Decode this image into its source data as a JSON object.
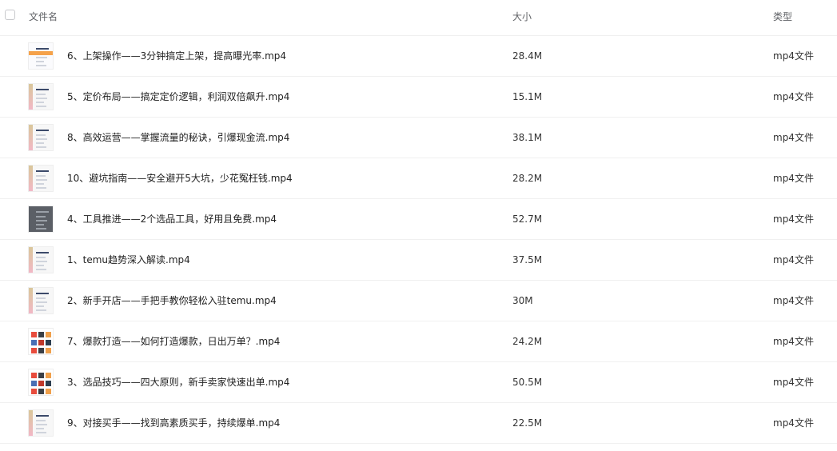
{
  "header": {
    "name_label": "文件名",
    "size_label": "大小",
    "type_label": "类型"
  },
  "rows": [
    {
      "name": "6、上架操作——3分钟搞定上架，提高曝光率.mp4",
      "size": "28.4M",
      "type": "mp4文件",
      "thumb": "orange"
    },
    {
      "name": "5、定价布局——搞定定价逻辑，利润双倍飙升.mp4",
      "size": "15.1M",
      "type": "mp4文件",
      "thumb": "doc"
    },
    {
      "name": "8、高效运营——掌握流量的秘诀，引爆现金流.mp4",
      "size": "38.1M",
      "type": "mp4文件",
      "thumb": "doc"
    },
    {
      "name": "10、避坑指南——安全避开5大坑，少花冤枉钱.mp4",
      "size": "28.2M",
      "type": "mp4文件",
      "thumb": "doc"
    },
    {
      "name": "4、工具推进——2个选品工具，好用且免费.mp4",
      "size": "52.7M",
      "type": "mp4文件",
      "thumb": "dark"
    },
    {
      "name": "1、temu趋势深入解读.mp4",
      "size": "37.5M",
      "type": "mp4文件",
      "thumb": "doc"
    },
    {
      "name": "2、新手开店——手把手教你轻松入驻temu.mp4",
      "size": "30M",
      "type": "mp4文件",
      "thumb": "doc"
    },
    {
      "name": "7、爆款打造——如何打造爆款，日出万单？.mp4",
      "size": "24.2M",
      "type": "mp4文件",
      "thumb": "grid"
    },
    {
      "name": "3、选品技巧——四大原则，新手卖家快速出单.mp4",
      "size": "50.5M",
      "type": "mp4文件",
      "thumb": "grid"
    },
    {
      "name": "9、对接买手——找到高素质买手，持续爆单.mp4",
      "size": "22.5M",
      "type": "mp4文件",
      "thumb": "doc"
    }
  ],
  "colors": {
    "doc_band_top": "#d9c79a",
    "doc_band_bottom": "#f2b8c6",
    "divider": "#f0f0f0"
  }
}
